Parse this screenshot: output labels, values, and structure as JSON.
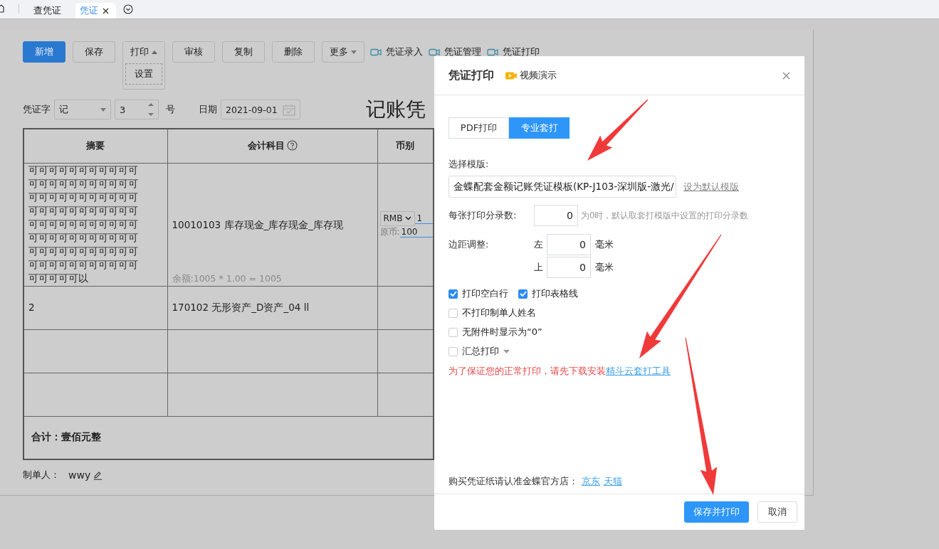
{
  "tabs": [
    {
      "label": "查凭证",
      "selected": false,
      "closable": false
    },
    {
      "label": "凭证",
      "selected": true,
      "closable": true
    }
  ],
  "toolbar": {
    "buttons": [
      {
        "label": "新增",
        "kind": "primary"
      },
      {
        "label": "保存",
        "kind": "plain"
      },
      {
        "label": "打印",
        "kind": "dropdown",
        "menu": "设置"
      },
      {
        "label": "审核",
        "kind": "plain"
      },
      {
        "label": "复制",
        "kind": "plain"
      },
      {
        "label": "删除",
        "kind": "plain"
      },
      {
        "label": "更多",
        "kind": "more"
      }
    ],
    "links": [
      "凭证录入",
      "凭证管理",
      "凭证打印"
    ]
  },
  "voucher_form": {
    "word_label": "凭证字",
    "word_value": "记",
    "number_value": "3",
    "number_suffix": "号",
    "date_label": "日期",
    "date_value": "2021-09-01",
    "title": "记账凭"
  },
  "table": {
    "columns": [
      "摘要",
      "会计科目",
      "币别"
    ],
    "rows": [
      {
        "summary": "可可可可可可可可可可可可可可可可可可可可可可可可可可可可可可可可可可可可可可可可可可可可可可可可可可可可可可可可可可可可可可可可可可可可可可可可可可可可可可可可可可可可可可可可可可可可可以",
        "account": "10010103 库存现金_库存现金_库存现",
        "balance": "余额:1005 * 1.00 = 1005",
        "currency": "RMB",
        "rate": "1",
        "original_label": "原币:",
        "original_value": "100"
      },
      {
        "summary": "2",
        "account": "170102 无形资产_D资产_04 ll"
      },
      {},
      {}
    ],
    "total": "合计：壹佰元整"
  },
  "maker": {
    "label": "制单人：",
    "name": "wwy"
  },
  "dialog": {
    "title": "凭证打印",
    "video_link": "视频演示",
    "modes": [
      {
        "label": "PDF打印",
        "selected": false
      },
      {
        "label": "专业套打",
        "selected": true
      }
    ],
    "template_label": "选择模版:",
    "template_value": "金蝶配套金额记账凭证模板(KP-J103-深圳版-激光/",
    "set_default_link": "设为默认模版",
    "entries_label": "每张打印分录数:",
    "entries_value": "0",
    "entries_hint": "为0时，默认取套打模版中设置的打印分录数",
    "margin_label": "边距调整:",
    "margins": [
      {
        "side": "左",
        "value": "0",
        "unit": "毫米"
      },
      {
        "side": "上",
        "value": "0",
        "unit": "毫米"
      }
    ],
    "options": [
      {
        "label": "打印空白行",
        "checked": true
      },
      {
        "label": "打印表格线",
        "checked": true
      },
      {
        "label": "不打印制单人姓名",
        "checked": false
      },
      {
        "label": "无附件时显示为“0”",
        "checked": false
      },
      {
        "label": "汇总打印",
        "checked": false,
        "has_dropdown": true
      }
    ],
    "warning": "为了保证您的正常打印，请先下载安装",
    "warning_link": "精斗云套打工具",
    "shop_text": "购买凭证纸请认准金蝶官方店：",
    "shop_links": [
      "京东",
      "天猫"
    ],
    "buttons": [
      {
        "label": "保存并打印",
        "kind": "primary"
      },
      {
        "label": "取消",
        "kind": "plain"
      }
    ]
  }
}
